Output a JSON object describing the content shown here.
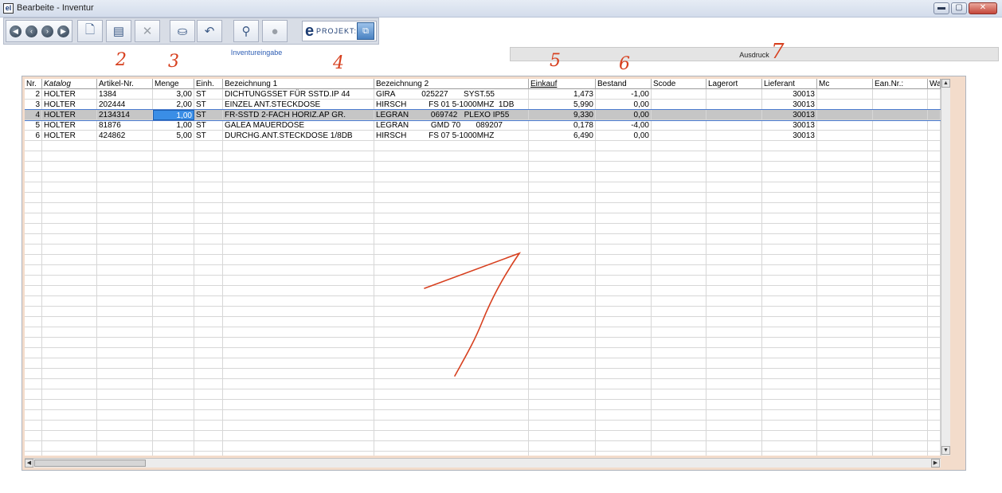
{
  "window": {
    "app_icon_text": "el",
    "title": "Bearbeite - Inventur",
    "buttons": {
      "minimize": "▬",
      "maximize": "▢",
      "close": "✕"
    }
  },
  "toolbar": {
    "nav_icons": [
      "first-record-icon",
      "previous-record-icon",
      "next-record-icon",
      "last-record-icon"
    ],
    "eprojekt_logo_letter": "e",
    "eprojekt_label": "PROJEKT:"
  },
  "tabs": [
    {
      "label": "Inventureingabe",
      "active": true
    },
    {
      "label": "Ausdruck",
      "active": false
    }
  ],
  "grid": {
    "columns": [
      "Nr.",
      "Katalog",
      "Artikel-Nr.",
      "Menge",
      "Einh.",
      "Bezeichnung 1",
      "Bezeichnung 2",
      "Einkauf",
      "Bestand",
      "Scode",
      "Lagerort",
      "Lieferant",
      "Mc",
      "Ean.Nr.:",
      "Wa"
    ],
    "rows": [
      {
        "nr": "2",
        "katalog": "HOLTER",
        "artikel": "1384",
        "menge": "3,00",
        "einh": "ST",
        "bez1": "DICHTUNGSSET FÜR SSTD.IP 44",
        "bez2": "GIRA            025227       SYST.55",
        "einkauf": "1,473",
        "bestand": "-1,00",
        "scode": "",
        "lagerort": "",
        "lieferant": "30013",
        "mc": "",
        "ean": "",
        "wa": ""
      },
      {
        "nr": "3",
        "katalog": "HOLTER",
        "artikel": "202444",
        "menge": "2,00",
        "einh": "ST",
        "bez1": "EINZEL ANT.STECKDOSE",
        "bez2": "HIRSCH          FS 01 5-1000MHZ  1DB",
        "einkauf": "5,990",
        "bestand": "0,00",
        "scode": "",
        "lagerort": "",
        "lieferant": "30013",
        "mc": "",
        "ean": "",
        "wa": ""
      },
      {
        "nr": "4",
        "katalog": "HOLTER",
        "artikel": "2134314",
        "menge": "1,00",
        "einh": "ST",
        "bez1": "FR-SSTD 2-FACH HORIZ.AP GR.",
        "bez2": "LEGRAN          069742   PLEXO IP55",
        "einkauf": "9,330",
        "bestand": "0,00",
        "scode": "",
        "lagerort": "",
        "lieferant": "30013",
        "mc": "",
        "ean": "",
        "wa": ""
      },
      {
        "nr": "5",
        "katalog": "HOLTER",
        "artikel": "81876",
        "menge": "1,00",
        "einh": "ST",
        "bez1": "GALEA MAUERDOSE",
        "bez2": "LEGRAN          GMD 70       089207",
        "einkauf": "0,178",
        "bestand": "-4,00",
        "scode": "",
        "lagerort": "",
        "lieferant": "30013",
        "mc": "",
        "ean": "",
        "wa": ""
      },
      {
        "nr": "6",
        "katalog": "HOLTER",
        "artikel": "424862",
        "menge": "5,00",
        "einh": "ST",
        "bez1": "DURCHG.ANT.STECKDOSE 1/8DB",
        "bez2": "HIRSCH          FS 07 5-1000MHZ",
        "einkauf": "6,490",
        "bestand": "0,00",
        "scode": "",
        "lagerort": "",
        "lieferant": "30013",
        "mc": "",
        "ean": "",
        "wa": ""
      }
    ],
    "selected_row": 2,
    "editing_cell": "menge"
  },
  "annotations": {
    "n2": "2",
    "n3": "3",
    "n4": "4",
    "n5": "5",
    "n6": "6",
    "n7": "7",
    "n1": "1",
    "color": "#d7401f"
  }
}
